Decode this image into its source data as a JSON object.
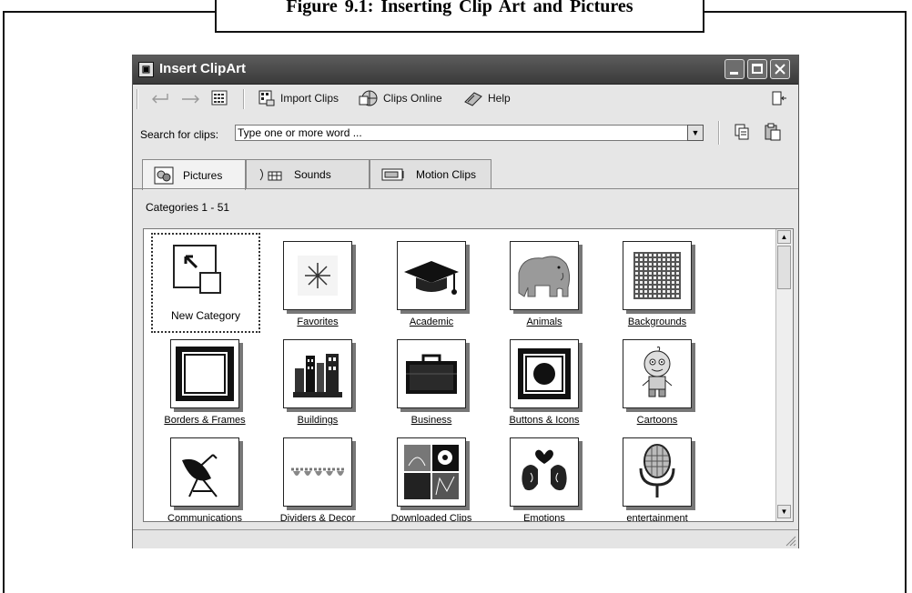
{
  "figure_caption": "Figure 9.1: Inserting Clip Art and Pictures",
  "window": {
    "title": "Insert ClipArt",
    "title_icon": "clipart-app-icon",
    "controls": [
      "minimize-icon",
      "maximize-icon",
      "close-icon"
    ]
  },
  "toolbar": {
    "back_icon": "back-arrow-icon",
    "forward_icon": "forward-arrow-icon",
    "view_icon": "grid-view-icon",
    "import_label": "Import Clips",
    "online_label": "Clips Online",
    "help_label": "Help",
    "restore_icon": "change-window-icon"
  },
  "search": {
    "label": "Search for clips:",
    "value": "Type one or more word ..."
  },
  "clipboard_icons": [
    "copy-icon",
    "paste-icon"
  ],
  "tabs": [
    {
      "label": "Pictures",
      "icon": "pictures-icon",
      "active": true
    },
    {
      "label": "Sounds",
      "icon": "sounds-icon",
      "active": false
    },
    {
      "label": "Motion Clips",
      "icon": "motion-clips-icon",
      "active": false
    }
  ],
  "categories_count": "Categories 1 - 51",
  "categories": [
    {
      "label": "New Category",
      "icon": "new-category-icon"
    },
    {
      "label": "Favorites",
      "icon": "favorites-icon"
    },
    {
      "label": "Academic",
      "icon": "graduation-cap-icon"
    },
    {
      "label": "Animals",
      "icon": "elephant-icon"
    },
    {
      "label": "Backgrounds",
      "icon": "dotted-background-icon"
    },
    {
      "label": "Borders & Frames",
      "icon": "frame-icon"
    },
    {
      "label": "Buildings",
      "icon": "buildings-icon"
    },
    {
      "label": "Business",
      "icon": "briefcase-icon"
    },
    {
      "label": "Buttons & Icons",
      "icon": "button-icon"
    },
    {
      "label": "Cartoons",
      "icon": "cartoon-character-icon"
    },
    {
      "label": "Communications",
      "icon": "satellite-dish-icon"
    },
    {
      "label": "Dividers & Decor",
      "icon": "divider-icon"
    },
    {
      "label": "Downloaded Clips",
      "icon": "downloaded-clips-icon"
    },
    {
      "label": "Emotions",
      "icon": "emotions-icon"
    },
    {
      "label": "entertainment",
      "icon": "microphone-icon"
    }
  ]
}
